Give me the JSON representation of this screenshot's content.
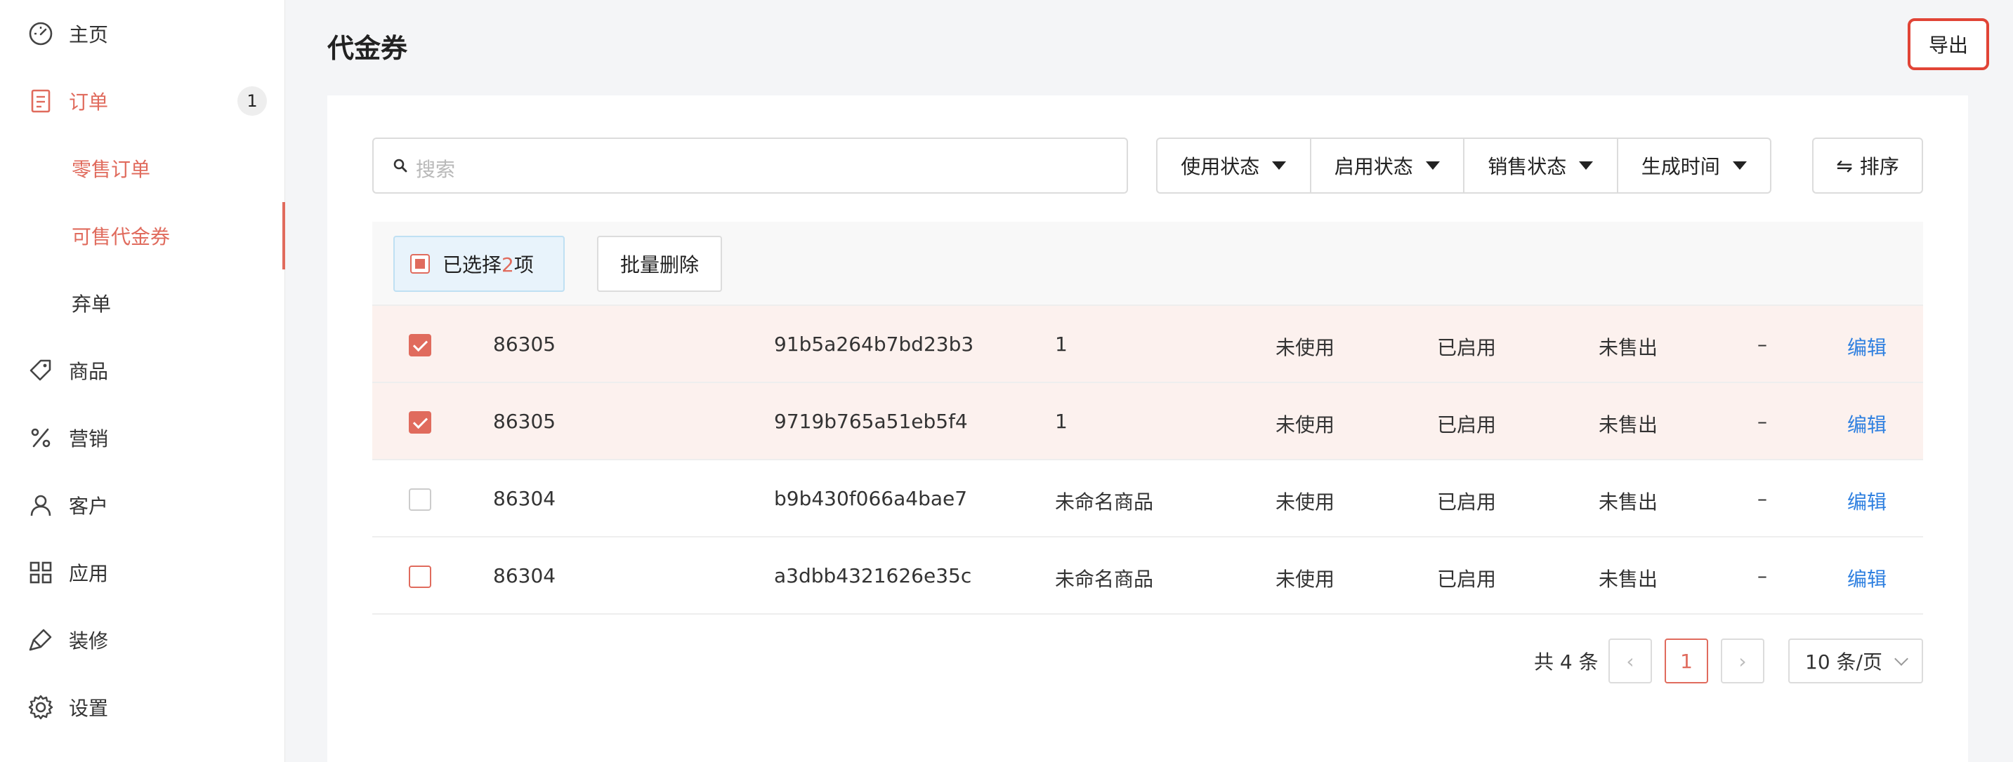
{
  "sidebar": {
    "items": [
      {
        "label": "主页",
        "icon": "dashboard-icon"
      },
      {
        "label": "订单",
        "icon": "order-icon",
        "badge": "1",
        "active": true
      },
      {
        "label": "商品",
        "icon": "tag-icon"
      },
      {
        "label": "营销",
        "icon": "percent-icon"
      },
      {
        "label": "客户",
        "icon": "user-icon"
      },
      {
        "label": "应用",
        "icon": "apps-icon"
      },
      {
        "label": "装修",
        "icon": "brush-icon"
      },
      {
        "label": "设置",
        "icon": "gear-icon"
      }
    ],
    "sub_items": [
      {
        "label": "零售订单"
      },
      {
        "label": "可售代金券"
      },
      {
        "label": "弃单"
      }
    ],
    "accent": "#e06b5d"
  },
  "header": {
    "title": "代金券",
    "export_label": "导出"
  },
  "toolbar": {
    "search_placeholder": "搜索",
    "filters": [
      "使用状态",
      "启用状态",
      "销售状态",
      "生成时间"
    ],
    "sort_label": "排序"
  },
  "bulk": {
    "selected_prefix": "已选择",
    "selected_count": "2",
    "selected_suffix": "项",
    "delete_label": "批量删除"
  },
  "table": {
    "rows": [
      {
        "checked": true,
        "id": "86305",
        "code": "91b5a264b7bd23b3",
        "product": "1",
        "use_status": "未使用",
        "enable_status": "已启用",
        "sale_status": "未售出",
        "extra": "–",
        "action": "编辑"
      },
      {
        "checked": true,
        "id": "86305",
        "code": "9719b765a51eb5f4",
        "product": "1",
        "use_status": "未使用",
        "enable_status": "已启用",
        "sale_status": "未售出",
        "extra": "–",
        "action": "编辑"
      },
      {
        "checked": false,
        "id": "86304",
        "code": "b9b430f066a4bae7",
        "product": "未命名商品",
        "use_status": "未使用",
        "enable_status": "已启用",
        "sale_status": "未售出",
        "extra": "–",
        "action": "编辑"
      },
      {
        "checked": false,
        "id": "86304",
        "code": "a3dbb4321626e35c",
        "product": "未命名商品",
        "use_status": "未使用",
        "enable_status": "已启用",
        "sale_status": "未售出",
        "extra": "–",
        "action": "编辑"
      }
    ]
  },
  "pagination": {
    "total": "共 4 条",
    "current_page": "1",
    "page_size": "10 条/页"
  }
}
